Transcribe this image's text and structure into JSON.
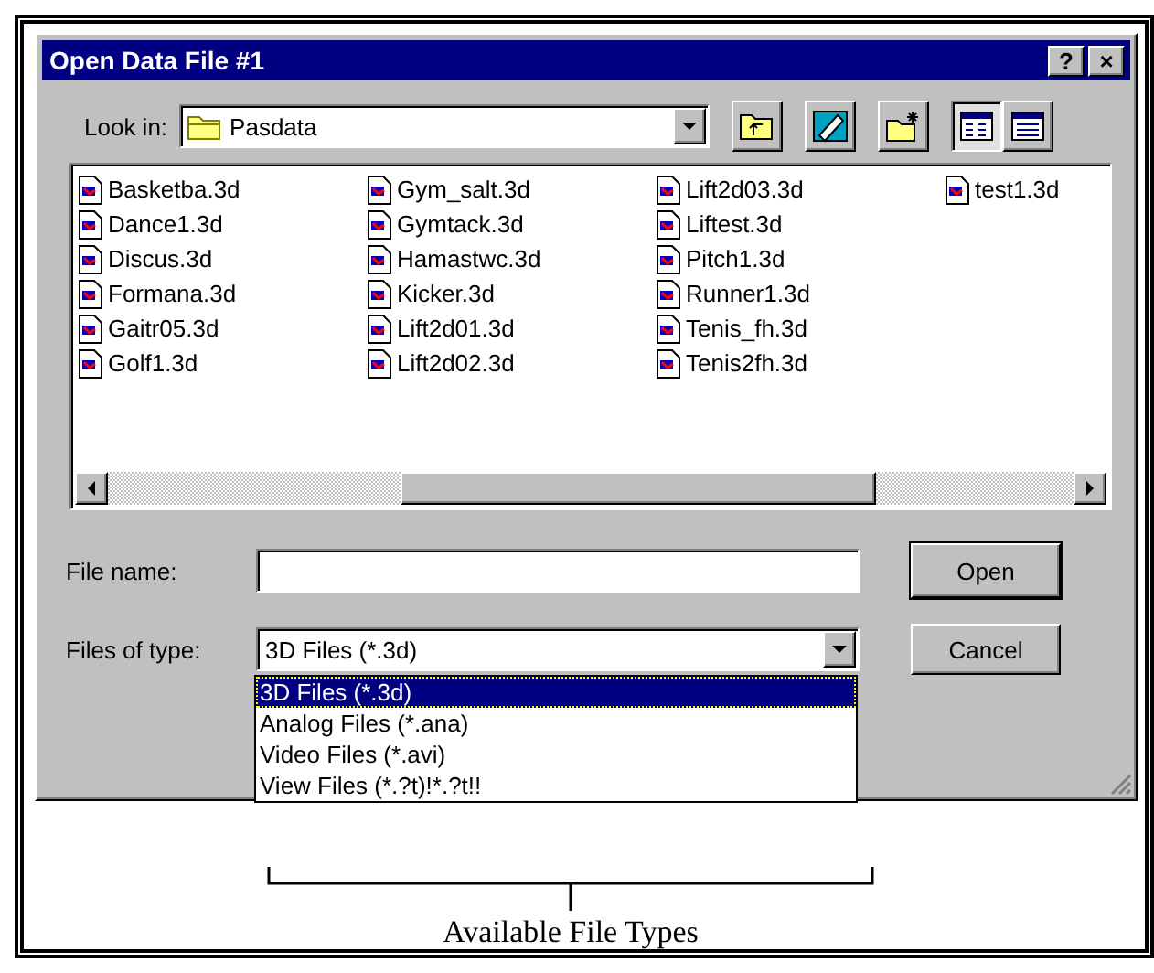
{
  "window": {
    "title": "Open Data File #1",
    "title_buttons": [
      "?",
      "×"
    ]
  },
  "look_in": {
    "label": "Look in:",
    "value": "Pasdata"
  },
  "toolbar": [
    {
      "kind": "up"
    },
    {
      "kind": "desktop"
    },
    {
      "kind": "newfolder"
    },
    {
      "kind": "list",
      "selected": true
    },
    {
      "kind": "details",
      "selected": false
    }
  ],
  "files": [
    "Basketba.3d",
    "Dance1.3d",
    "Discus.3d",
    "Formana.3d",
    "Gaitr05.3d",
    "Golf1.3d",
    "Gym_salt.3d",
    "Gymtack.3d",
    "Hamastwc.3d",
    "Kicker.3d",
    "Lift2d01.3d",
    "Lift2d02.3d",
    "Lift2d03.3d",
    "Liftest.3d",
    "Pitch1.3d",
    "Runner1.3d",
    "Tenis_fh.3d",
    "Tenis2fh.3d",
    "test1.3d"
  ],
  "file_name": {
    "label": "File name:"
  },
  "file_type": {
    "label": "Files of type:",
    "value": "3D Files (*.3d)",
    "expanded": true,
    "options": [
      {
        "label": "3D Files (*.3d)",
        "selected": true
      },
      {
        "label": "Analog Files (*.ana)",
        "selected": false
      },
      {
        "label": "Video Files (*.avi)",
        "selected": false
      },
      {
        "label": "View Files (*.?t)!*.?t!!",
        "selected": false
      }
    ]
  },
  "buttons": [
    "Open",
    "Cancel"
  ],
  "annotation": "Available File Types"
}
